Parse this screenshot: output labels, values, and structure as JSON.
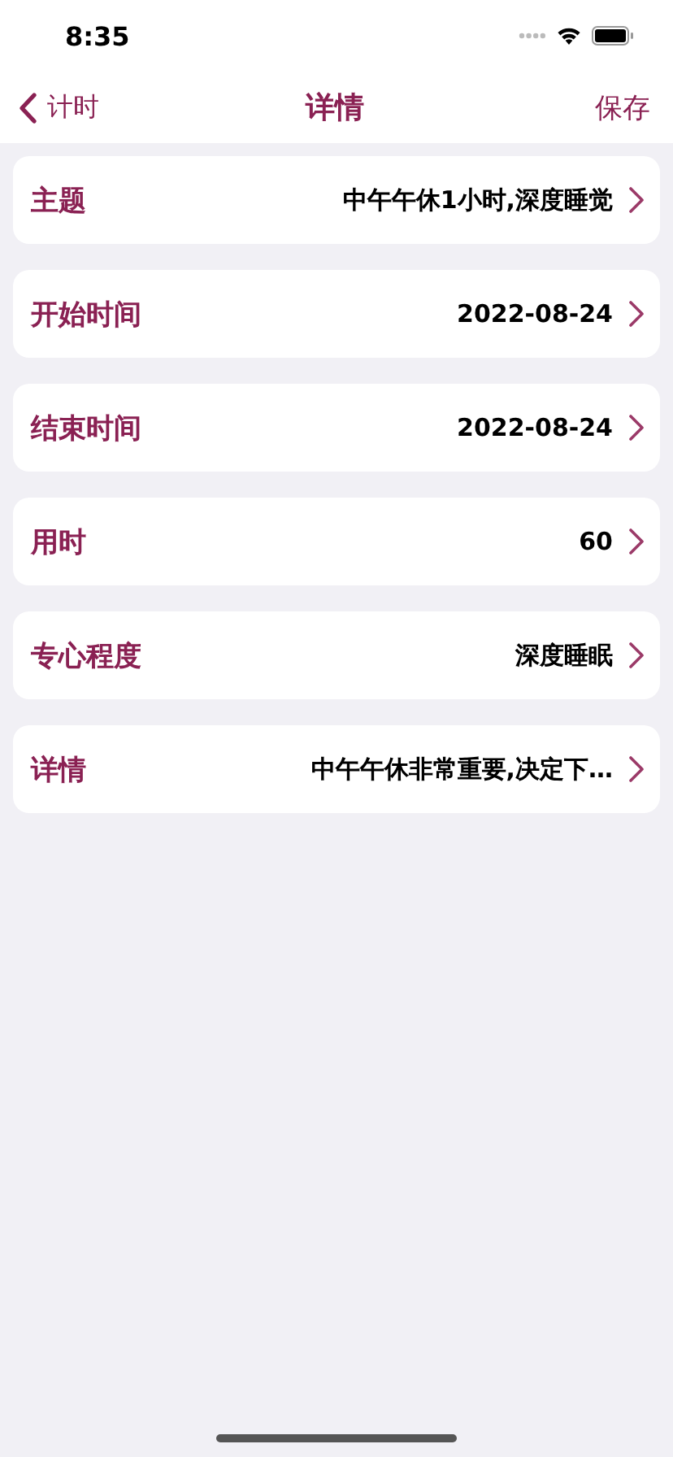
{
  "status_bar": {
    "time": "8:35"
  },
  "nav": {
    "back": "计时",
    "title": "详情",
    "action": "保存"
  },
  "rows": [
    {
      "label": "主题",
      "value": "中午午休1小时,深度睡觉"
    },
    {
      "label": "开始时间",
      "value": "2022-08-24"
    },
    {
      "label": "结束时间",
      "value": "2022-08-24"
    },
    {
      "label": "用时",
      "value": "60"
    },
    {
      "label": "专心程度",
      "value": "深度睡眠"
    },
    {
      "label": "详情",
      "value": "中午午休非常重要,决定下…"
    }
  ]
}
